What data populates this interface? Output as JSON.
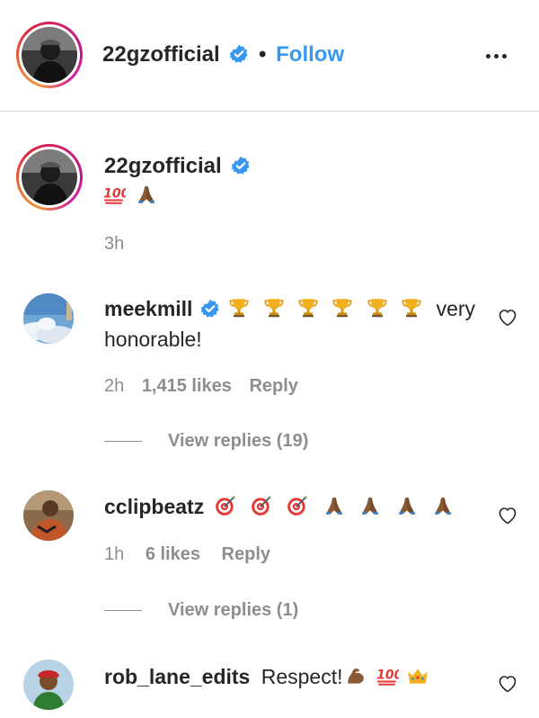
{
  "header": {
    "username": "22gzofficial",
    "separator": "•",
    "follow_label": "Follow"
  },
  "caption": {
    "username": "22gzofficial",
    "emojis": [
      "hundred-points",
      "folded-hands"
    ],
    "time": "3h"
  },
  "comments": [
    {
      "username": "meekmill",
      "verified": true,
      "emojis": [
        "trophy",
        "trophy",
        "trophy",
        "trophy",
        "trophy",
        "trophy"
      ],
      "text_line1": "very",
      "text_line2": "honorable!",
      "time": "2h",
      "likes": "1,415 likes",
      "reply_label": "Reply",
      "view_replies": "View replies (19)"
    },
    {
      "username": "cclipbeatz",
      "verified": false,
      "emojis": [
        "direct-hit",
        "direct-hit",
        "direct-hit",
        "folded-hands",
        "folded-hands",
        "folded-hands",
        "folded-hands"
      ],
      "time": "1h",
      "likes": "6 likes",
      "reply_label": "Reply",
      "view_replies": "View replies (1)"
    },
    {
      "username": "rob_lane_edits",
      "verified": false,
      "text": "Respect!",
      "emojis": [
        "flexed-biceps",
        "hundred-points",
        "crown"
      ]
    }
  ],
  "colors": {
    "link_blue": "#3897f0",
    "text": "#262626",
    "secondary": "#8e8e8e",
    "divider": "#dbdbdb"
  }
}
